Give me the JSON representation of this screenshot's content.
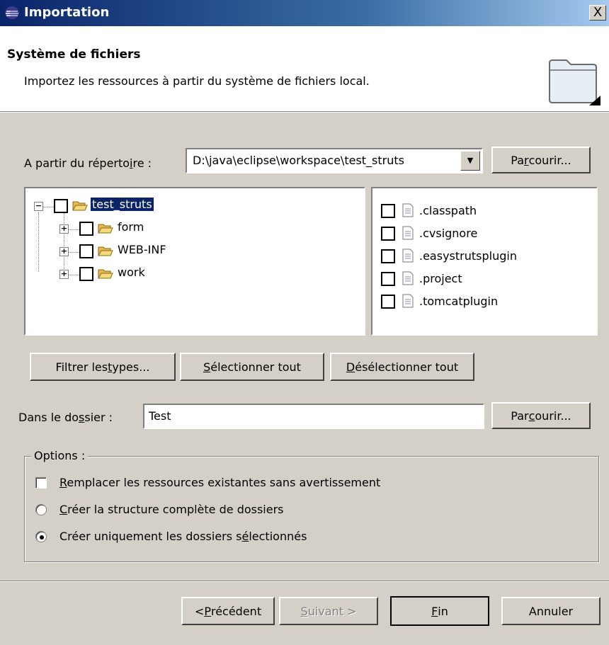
{
  "window": {
    "title": "Importation",
    "close_label": "X",
    "title_icon": "eclipse-icon"
  },
  "banner": {
    "title": "Système de fichiers",
    "description": "Importez les ressources à partir du système de fichiers local.",
    "icon": "folder-wizard-icon"
  },
  "source": {
    "label_pre": "A partir du réperto",
    "label_mnemonic": "i",
    "label_post": "re :",
    "value": "D:\\java\\eclipse\\workspace\\test_struts",
    "browse_pre": "Pa",
    "browse_mnemonic": "r",
    "browse_post": "courir..."
  },
  "tree": {
    "root": {
      "label": "test_struts",
      "expander": "−",
      "checked": false,
      "selected": true
    },
    "children": [
      {
        "label": "form",
        "expander": "+",
        "checked": false
      },
      {
        "label": "WEB-INF",
        "expander": "+",
        "checked": false
      },
      {
        "label": "work",
        "expander": "+",
        "checked": false
      }
    ]
  },
  "files": [
    {
      "label": ".classpath",
      "checked": false
    },
    {
      "label": ".cvsignore",
      "checked": false
    },
    {
      "label": ".easystrutsplugin",
      "checked": false
    },
    {
      "label": ".project",
      "checked": false
    },
    {
      "label": ".tomcatplugin",
      "checked": false
    }
  ],
  "selection_buttons": {
    "filter_pre": "Filtrer les ",
    "filter_mnemonic": "t",
    "filter_post": "ypes...",
    "select_all_mnemonic": "S",
    "select_all_post": "électionner tout",
    "deselect_all_mnemonic": "D",
    "deselect_all_post": "ésélectionner tout"
  },
  "destination": {
    "label_pre": "Dans le do",
    "label_mnemonic": "s",
    "label_post": "sier :",
    "value": "Test",
    "browse_pre": "Par",
    "browse_mnemonic": "c",
    "browse_post": "ourir..."
  },
  "options": {
    "legend": "Options :",
    "overwrite_mnemonic": "R",
    "overwrite_post": "emplacer les ressources existantes sans avertissement",
    "overwrite_checked": false,
    "full_structure_mnemonic": "C",
    "full_structure_post": "réer la structure complète de dossiers",
    "full_structure_selected": false,
    "selected_only_pre": "Créer uniquement les dossiers s",
    "selected_only_mnemonic": "é",
    "selected_only_post": "lectionnés",
    "selected_only_selected": true
  },
  "footer": {
    "back_pre": "< ",
    "back_mnemonic": "P",
    "back_post": "récédent",
    "next_mnemonic": "S",
    "next_post": "uivant >",
    "finish_mnemonic": "F",
    "finish_post": "in",
    "cancel": "Annuler"
  }
}
